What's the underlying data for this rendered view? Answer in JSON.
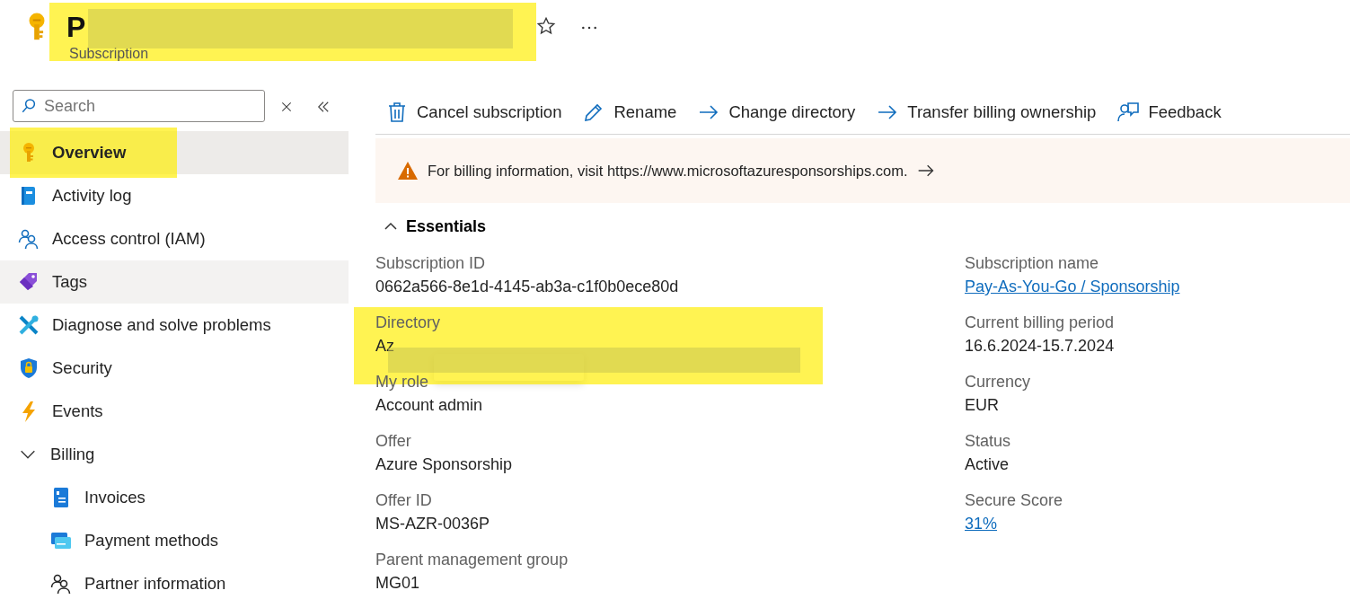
{
  "header": {
    "title": "P",
    "subtitle": "Subscription",
    "title_redacted": true
  },
  "search": {
    "placeholder": "Search"
  },
  "nav": [
    {
      "label": "Overview",
      "selected": true,
      "hovered": false,
      "highlighted": true
    },
    {
      "label": "Activity log",
      "selected": false,
      "hovered": false,
      "highlighted": false
    },
    {
      "label": "Access control (IAM)",
      "selected": false,
      "hovered": false,
      "highlighted": false
    },
    {
      "label": "Tags",
      "selected": false,
      "hovered": true,
      "highlighted": false
    },
    {
      "label": "Diagnose and solve problems",
      "selected": false,
      "hovered": false,
      "highlighted": false
    },
    {
      "label": "Security",
      "selected": false,
      "hovered": false,
      "highlighted": false
    },
    {
      "label": "Events",
      "selected": false,
      "hovered": false,
      "highlighted": false
    },
    {
      "label": "Billing",
      "selected": false,
      "hovered": false,
      "highlighted": false,
      "expanded": true,
      "children": [
        {
          "label": "Invoices"
        },
        {
          "label": "Payment methods"
        },
        {
          "label": "Partner information"
        }
      ]
    }
  ],
  "toolbar": [
    "Cancel subscription",
    "Rename",
    "Change directory",
    "Transfer billing ownership",
    "Feedback"
  ],
  "banner": {
    "text": "For billing information, visit https://www.microsoftazuresponsorships.com."
  },
  "essentials": {
    "title": "Essentials",
    "expanded": true,
    "left": [
      {
        "label": "Subscription ID",
        "value": "0662a566-8e1d-4145-ab3a-c1f0b0ece80d",
        "kind": "text"
      },
      {
        "label": "Directory",
        "value": "Az",
        "kind": "redacted"
      },
      {
        "label": "My role",
        "value": "Account admin",
        "kind": "text"
      },
      {
        "label": "Offer",
        "value": "Azure Sponsorship",
        "kind": "text"
      },
      {
        "label": "Offer ID",
        "value": "MS-AZR-0036P",
        "kind": "text"
      },
      {
        "label": "Parent management group",
        "value": "MG01",
        "kind": "text"
      }
    ],
    "right": [
      {
        "label": "Subscription name",
        "value": "Pay-As-You-Go / Sponsorship",
        "kind": "link"
      },
      {
        "label": "Current billing period",
        "value": "16.6.2024-15.7.2024",
        "kind": "text"
      },
      {
        "label": "Currency",
        "value": "EUR",
        "kind": "text"
      },
      {
        "label": "Status",
        "value": "Active",
        "kind": "text"
      },
      {
        "label": "Secure Score",
        "value": "31%",
        "kind": "link"
      }
    ]
  }
}
